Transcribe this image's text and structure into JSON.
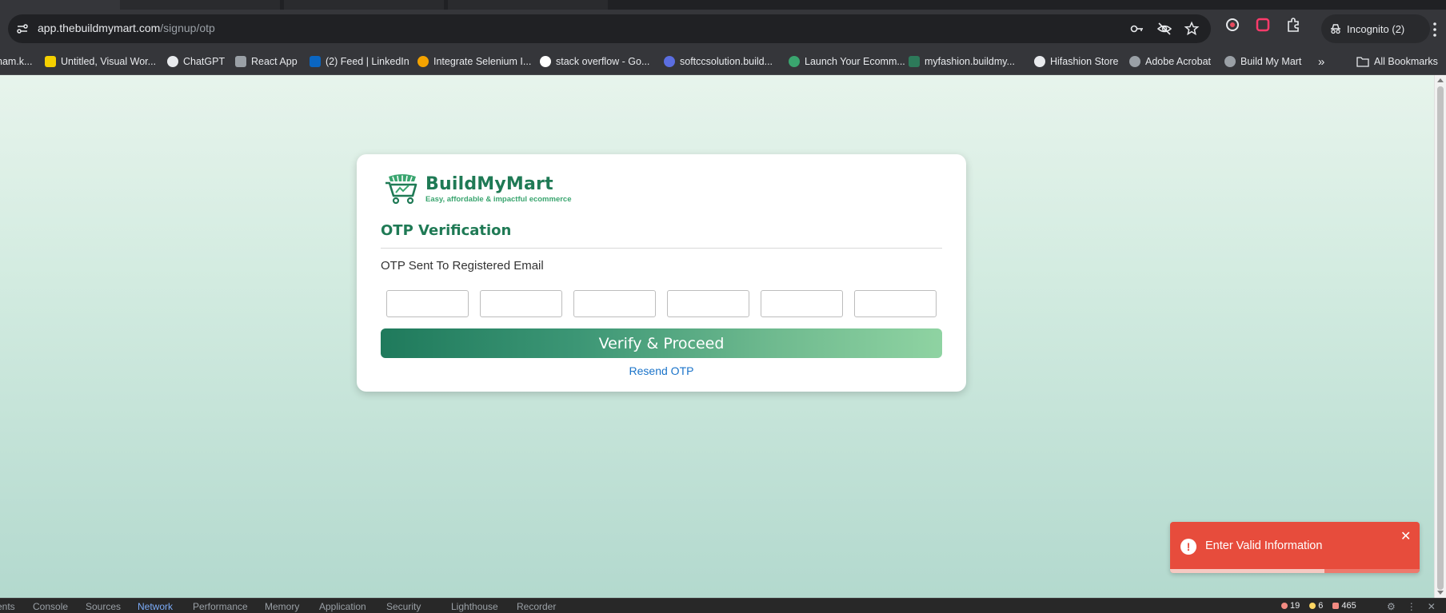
{
  "browser": {
    "url_host": "app.thebuildmymart.com",
    "url_path": "/signup/otp",
    "incognito_label": "Incognito (2)",
    "bookmarks": [
      {
        "label": "nam.k...",
        "fav_color": "#9aa0a6"
      },
      {
        "label": "Untitled, Visual Wor...",
        "fav_color": "#f5d000"
      },
      {
        "label": "ChatGPT",
        "fav_color": "#e8eaed"
      },
      {
        "label": "React App",
        "fav_color": "#9aa0a6"
      },
      {
        "label": "(2) Feed | LinkedIn",
        "fav_color": "#0a66c2"
      },
      {
        "label": "Integrate Selenium I...",
        "fav_color": "#f4a300"
      },
      {
        "label": "stack overflow - Go...",
        "fav_color": "#ffffff"
      },
      {
        "label": "softccsolution.build...",
        "fav_color": "#5b6ee1"
      },
      {
        "label": "Launch Your Ecomm...",
        "fav_color": "#3aa56f"
      },
      {
        "label": "myfashion.buildmy...",
        "fav_color": "#2d7a5a"
      },
      {
        "label": "Hifashion Store",
        "fav_color": "#e8eaed"
      },
      {
        "label": "Adobe Acrobat",
        "fav_color": "#9aa0a6"
      },
      {
        "label": "Build My Mart",
        "fav_color": "#9aa0a6"
      }
    ],
    "more_bookmarks": "»",
    "all_bookmarks": "All Bookmarks"
  },
  "card": {
    "brand_name": "BuildMyMart",
    "tagline": "Easy, affordable & impactful ecommerce",
    "title": "OTP Verification",
    "subtitle": "OTP Sent To Registered Email",
    "otp_inputs": [
      "",
      "",
      "",
      "",
      "",
      ""
    ],
    "verify_label": "Verify & Proceed",
    "resend_label": "Resend OTP"
  },
  "toast": {
    "message": "Enter Valid Information",
    "icon": "!",
    "close": "✕",
    "progress": 0.62,
    "color": "#e74c3c"
  },
  "devtools": {
    "tabs": [
      "ents",
      "Console",
      "Sources",
      "Network",
      "Performance",
      "Memory",
      "Application",
      "Security",
      "Lighthouse",
      "Recorder"
    ],
    "active_tab": "Network",
    "errors": "19",
    "warnings": "6",
    "issues": "465"
  },
  "colors": {
    "brand_green": "#1f7a55",
    "link_blue": "#1a73c9",
    "error_red": "#e74c3c"
  }
}
